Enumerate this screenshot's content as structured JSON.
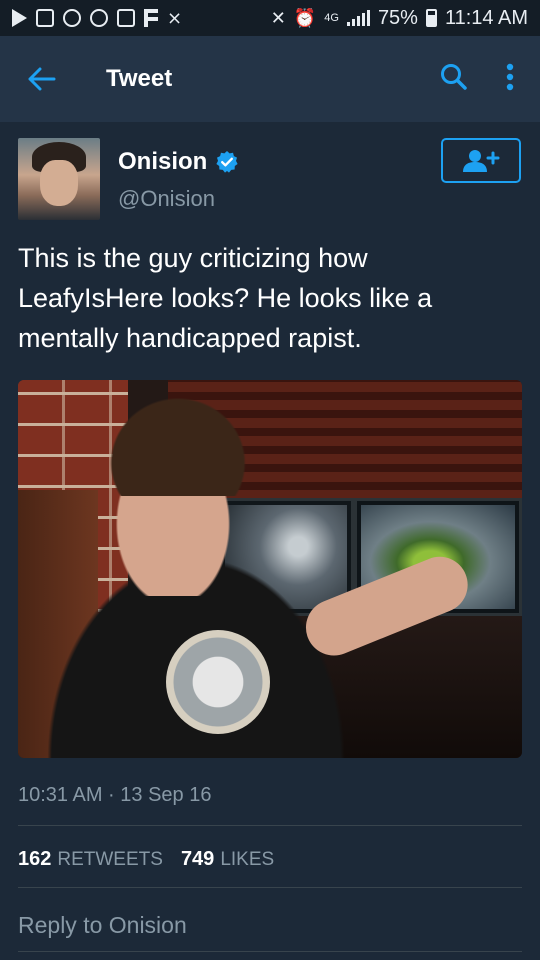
{
  "status_bar": {
    "battery": "75%",
    "time": "11:14 AM",
    "network": "4G"
  },
  "app_bar": {
    "title": "Tweet"
  },
  "tweet": {
    "display_name": "Onision",
    "handle": "@Onision",
    "verified": true,
    "text": "This is the guy criticizing how LeafyIsHere looks? He looks like a mentally handicapped rapist.",
    "timestamp": "10:31 AM · 13 Sep 16",
    "retweets_count": "162",
    "retweets_label": "RETWEETS",
    "likes_count": "749",
    "likes_label": "LIKES",
    "reply_placeholder": "Reply to Onision"
  },
  "colors": {
    "accent": "#1da1f2",
    "background": "#1c2938",
    "app_bar": "#243447",
    "muted_text": "#8899a6"
  },
  "icons": [
    "back-arrow-icon",
    "search-icon",
    "more-vertical-icon",
    "follow-user-icon",
    "verified-icon"
  ]
}
